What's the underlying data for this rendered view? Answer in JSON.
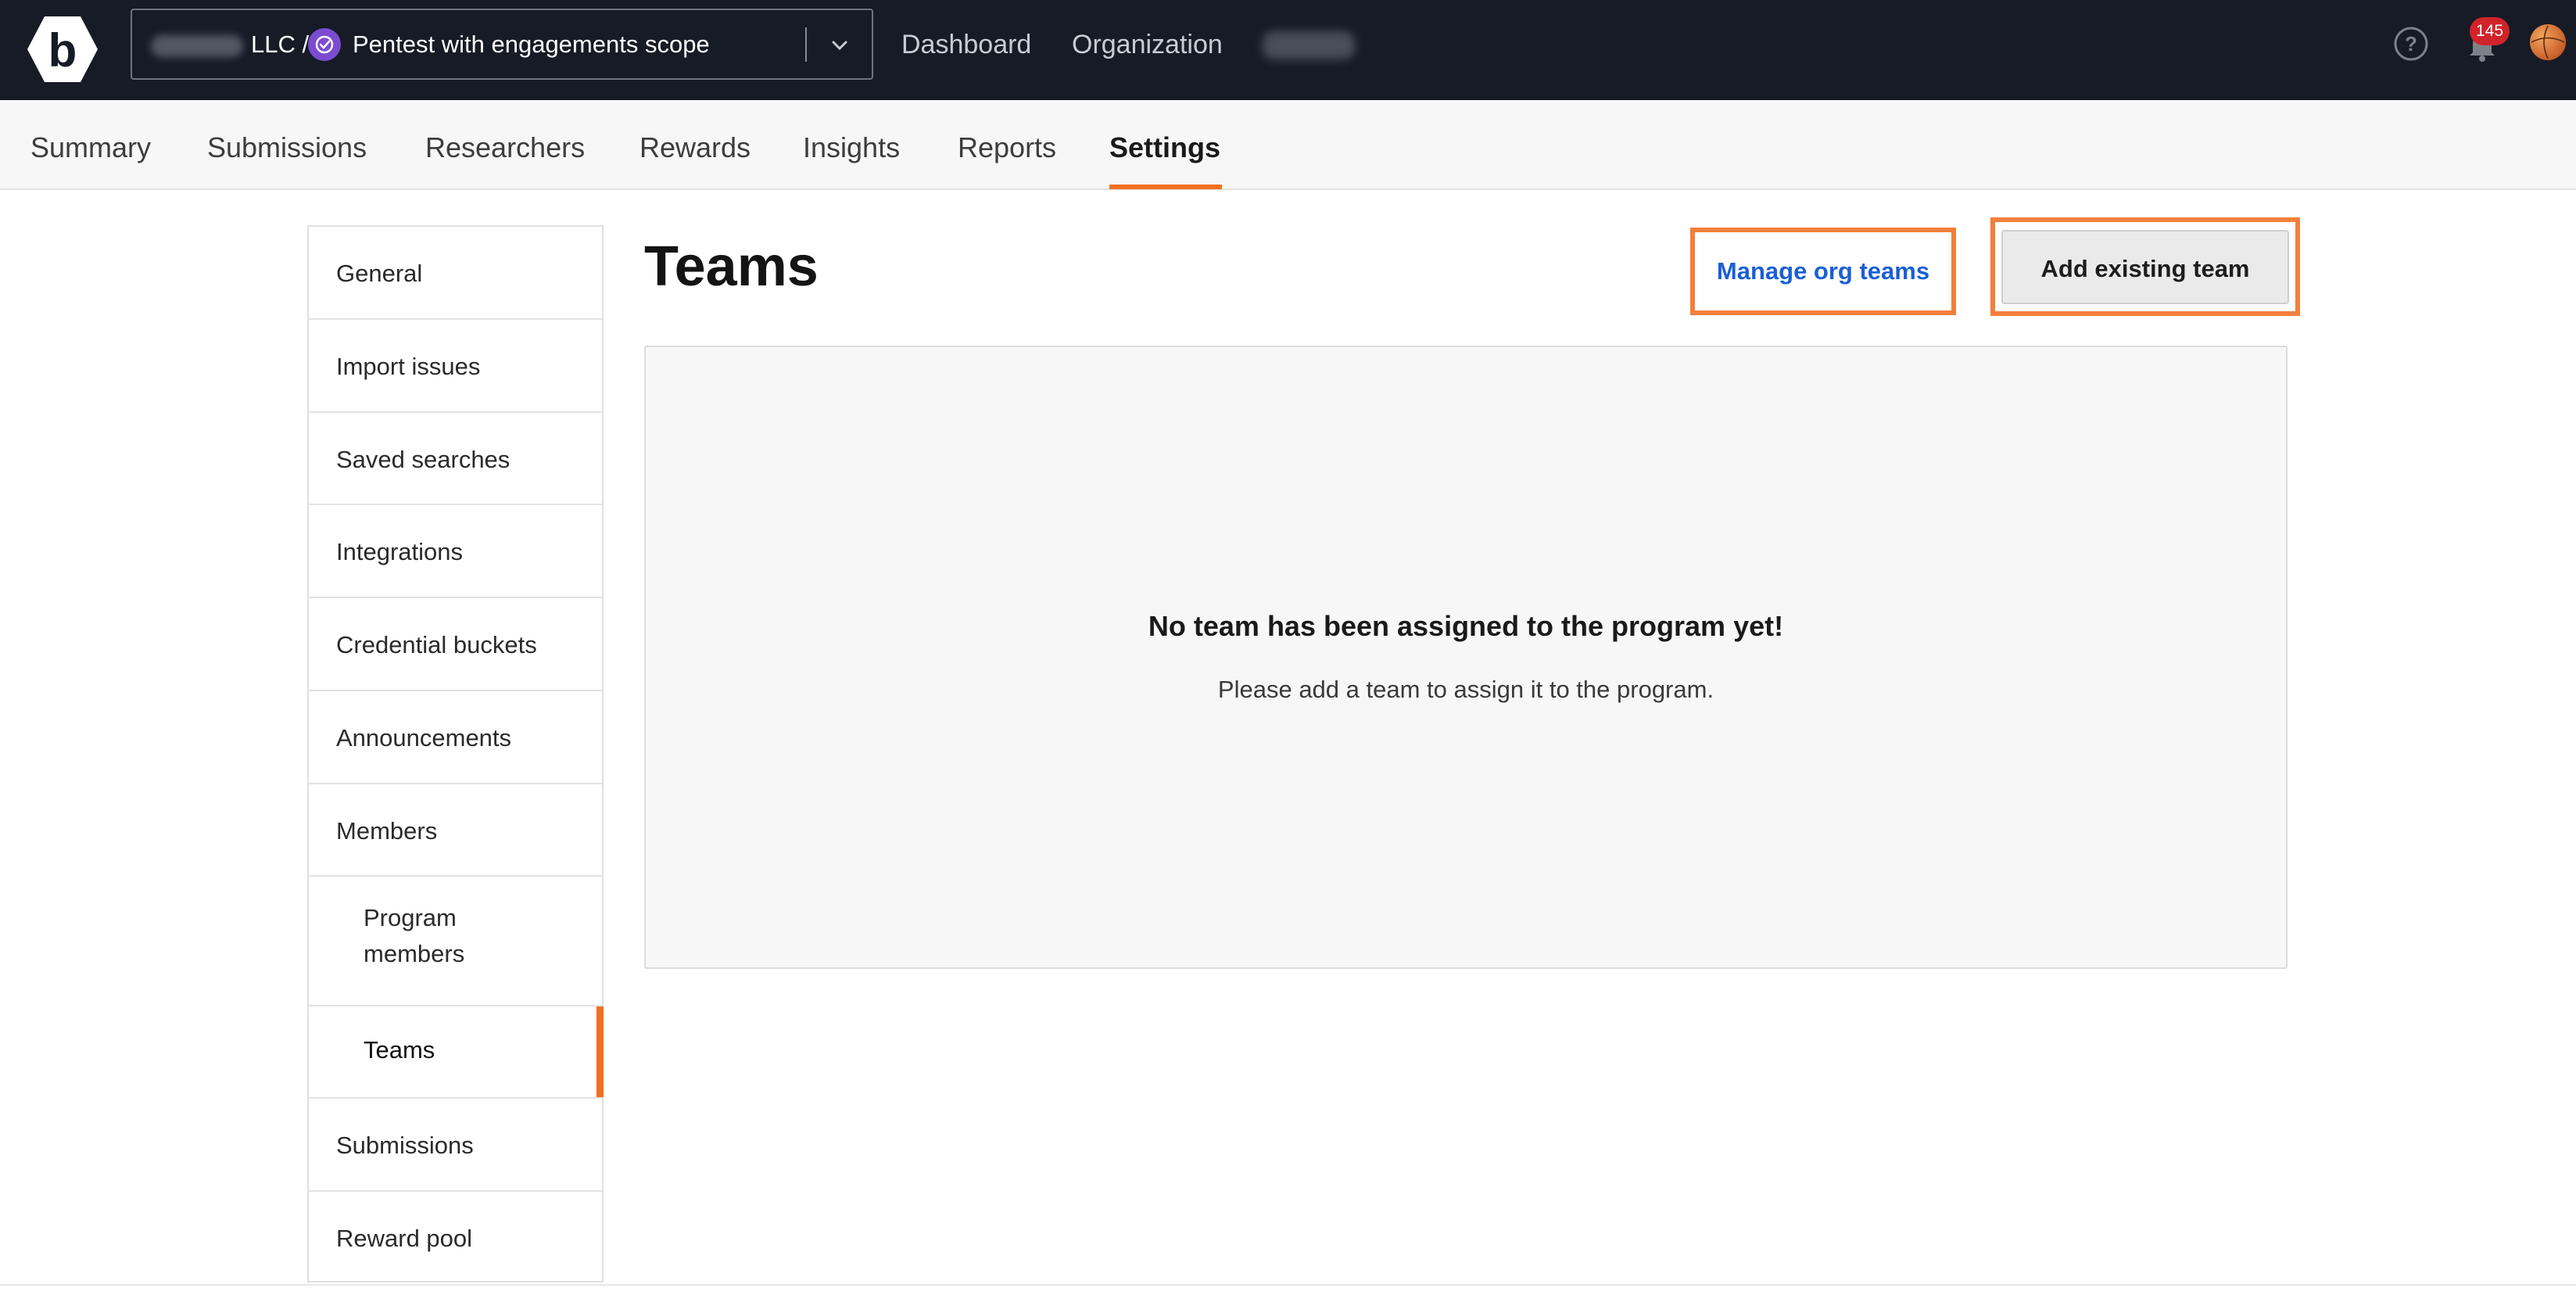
{
  "topbar": {
    "scope_org": "LLC /",
    "scope_name": "Pentest with engagements scope",
    "nav": [
      "Dashboard",
      "Organization"
    ],
    "notification_count": "145"
  },
  "tabs": [
    {
      "label": "Summary"
    },
    {
      "label": "Submissions"
    },
    {
      "label": "Researchers"
    },
    {
      "label": "Rewards"
    },
    {
      "label": "Insights"
    },
    {
      "label": "Reports"
    },
    {
      "label": "Settings",
      "active": true
    }
  ],
  "sidebar": {
    "items": [
      {
        "label": "General"
      },
      {
        "label": "Import issues"
      },
      {
        "label": "Saved searches"
      },
      {
        "label": "Integrations"
      },
      {
        "label": "Credential buckets"
      },
      {
        "label": "Announcements"
      },
      {
        "label": "Members"
      },
      {
        "label": "Program members"
      },
      {
        "label": "Teams",
        "active": true
      },
      {
        "label": "Submissions"
      },
      {
        "label": "Reward pool"
      }
    ]
  },
  "main": {
    "title": "Teams",
    "manage_label": "Manage org teams",
    "add_label": "Add existing team",
    "empty_title": "No team has been assigned to the program yet!",
    "empty_sub": "Please add a team to assign it to the program."
  },
  "colors": {
    "topbar_bg": "#171b26",
    "accent": "#f37021",
    "link": "#1a5fd6",
    "badge": "#d1232a"
  }
}
